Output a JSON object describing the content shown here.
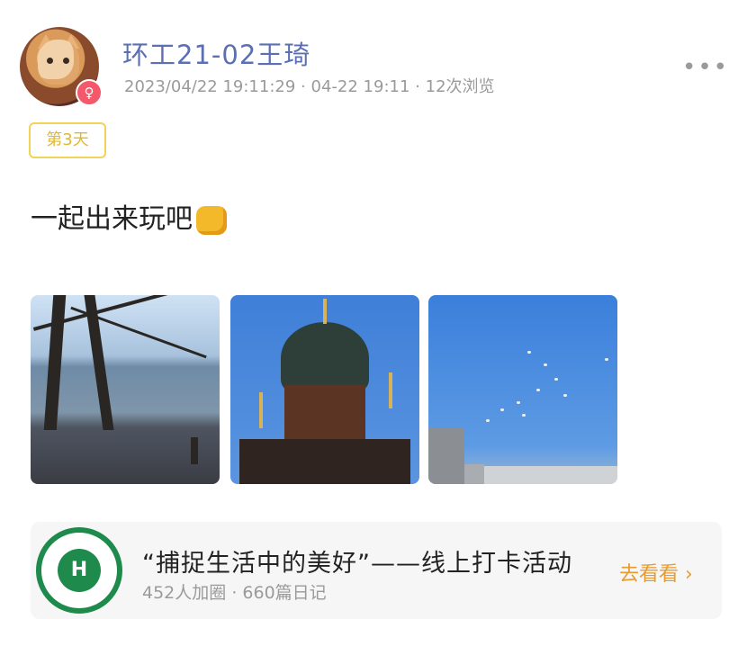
{
  "post": {
    "author_name": "环工21-02王琦",
    "timestamp": "2023/04/22 19:11:29",
    "date_short": "04-22 19:11",
    "views": "12次浏览",
    "meta_separator": "·",
    "day_badge": "第3天",
    "text": "一起出来玩吧",
    "emoji": "fist-emoji",
    "gender_icon": "female-icon",
    "photos": [
      {
        "name": "riverside-trees-photo"
      },
      {
        "name": "cathedral-photo"
      },
      {
        "name": "pigeons-sky-photo"
      }
    ]
  },
  "card": {
    "title": "“捕捉生活中的美好”——线上打卡活动",
    "members": "452人加圈",
    "separator": "·",
    "diaries": "660篇日记",
    "action_label": "去看看",
    "action_icon": "chevron-right-icon",
    "logo_text": "H"
  },
  "colors": {
    "name_color": "#5b6fb2",
    "badge_border": "#f2d35a",
    "action_color": "#e89a2e",
    "logo_green": "#1e8a4c"
  }
}
